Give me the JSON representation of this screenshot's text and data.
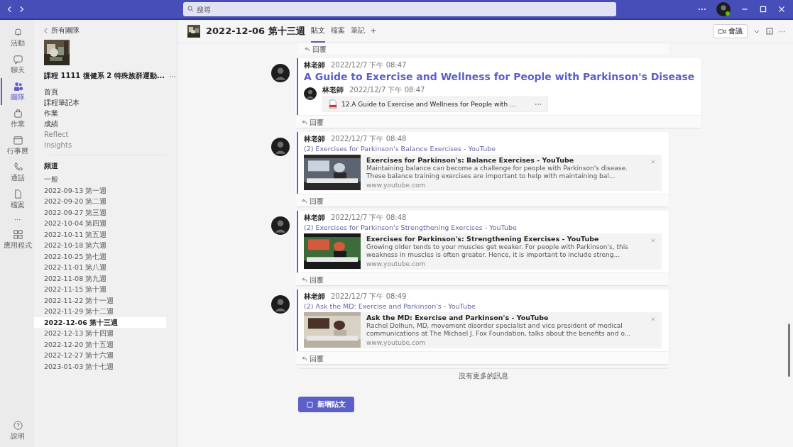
{
  "titlebar": {
    "search": {
      "placeholder": "搜尋"
    }
  },
  "rail": {
    "items": [
      {
        "label": "活動",
        "selected": false
      },
      {
        "label": "聊天",
        "selected": false
      },
      {
        "label": "團隊",
        "selected": true
      },
      {
        "label": "作業",
        "selected": false
      },
      {
        "label": "行事曆",
        "selected": false
      },
      {
        "label": "通話",
        "selected": false
      },
      {
        "label": "檔案",
        "selected": false
      },
      {
        "label": "⋯",
        "selected": false
      },
      {
        "label": "應用程式",
        "selected": false
      }
    ],
    "help": {
      "label": "說明"
    }
  },
  "sidebar": {
    "back": "所有團隊",
    "team_name": "課程 1111 復健系 2 特殊族群運動...",
    "team_more": "⋯",
    "menu": [
      {
        "label": "首頁",
        "dim": false
      },
      {
        "label": "課程筆記本",
        "dim": false
      },
      {
        "label": "作業",
        "dim": false
      },
      {
        "label": "成績",
        "dim": false
      },
      {
        "label": "Reflect",
        "dim": true
      },
      {
        "label": "Insights",
        "dim": true
      }
    ],
    "channels_heading": "頻道",
    "channels": [
      {
        "label": "一般",
        "selected": false
      },
      {
        "label": "2022-09-13 第一週",
        "selected": false
      },
      {
        "label": "2022-09-20 第二週",
        "selected": false
      },
      {
        "label": "2022-09-27 第三週",
        "selected": false
      },
      {
        "label": "2022-10-04 第四週",
        "selected": false
      },
      {
        "label": "2022-10-11 第五週",
        "selected": false
      },
      {
        "label": "2022-10-18 第六週",
        "selected": false
      },
      {
        "label": "2022-10-25 第七週",
        "selected": false
      },
      {
        "label": "2022-11-01 第八週",
        "selected": false
      },
      {
        "label": "2022-11-08 第九週",
        "selected": false
      },
      {
        "label": "2022-11-15 第十週",
        "selected": false
      },
      {
        "label": "2022-11-22 第十一週",
        "selected": false
      },
      {
        "label": "2022-11-29 第十二週",
        "selected": false
      },
      {
        "label": "2022-12-06 第十三週",
        "selected": true
      },
      {
        "label": "2022-12-13 第十四週",
        "selected": false
      },
      {
        "label": "2022-12-20 第十五週",
        "selected": false
      },
      {
        "label": "2022-12-27 第十六週",
        "selected": false
      },
      {
        "label": "2023-01-03 第十七週",
        "selected": false
      }
    ]
  },
  "channel_header": {
    "title": "2022-12-06 第十三週",
    "tabs": [
      {
        "label": "貼文",
        "selected": true
      },
      {
        "label": "檔案",
        "selected": false
      },
      {
        "label": "筆記",
        "selected": false
      }
    ],
    "add_tab": "+",
    "meet": "會議",
    "more": "⋯"
  },
  "top_reply": "回覆",
  "posts": [
    {
      "kind": "heading",
      "author": "林老師",
      "time": "2022/12/7 下午 08:47",
      "heading": "A Guide to Exercise and Wellness for People with Parkinson's Disease",
      "reply_author": "林老師",
      "reply_time": "2022/12/7 下午 08:47",
      "attachment": "12.A Guide to Exercise and Wellness for People with ...",
      "reply": "回覆"
    },
    {
      "kind": "link",
      "author": "林老師",
      "time": "2022/12/7 下午 08:48",
      "link": "(2) Exercises for Parkinson's Balance Exercises - YouTube",
      "card_title": "Exercises for Parkinson's: Balance Exercises - YouTube",
      "card_text": "Maintaining balance can become a challenge for people with Parkinson's disease. These balance training exercises are important to help with maintaining bal...",
      "domain": "www.youtube.com",
      "reply": "回覆"
    },
    {
      "kind": "link",
      "author": "林老師",
      "time": "2022/12/7 下午 08:48",
      "link": "(2) Exercises for Parkinson's Strengthening Exercises - YouTube",
      "card_title": "Exercises for Parkinson's: Strengthening Exercises - YouTube",
      "card_text": "Growing older tends to your muscles get weaker. For people with Parkinson's, this weakness in muscles is often greater. Hence, it is important to include streng...",
      "domain": "www.youtube.com",
      "reply": "回覆"
    },
    {
      "kind": "link",
      "author": "林老師",
      "time": "2022/12/7 下午 08:49",
      "link": "(2) Ask the MD: Exercise and Parkinson's - YouTube",
      "card_title": "Ask the MD: Exercise and Parkinson's - YouTube",
      "card_text": "Rachel Dolhun, MD, movement disorder specialist and vice president of medical communications at The Michael J. Fox Foundation, talks about the benefits and o...",
      "domain": "www.youtube.com",
      "reply": "回覆"
    }
  ],
  "end_note": "沒有更多的訊息",
  "new_post": "新增貼文"
}
